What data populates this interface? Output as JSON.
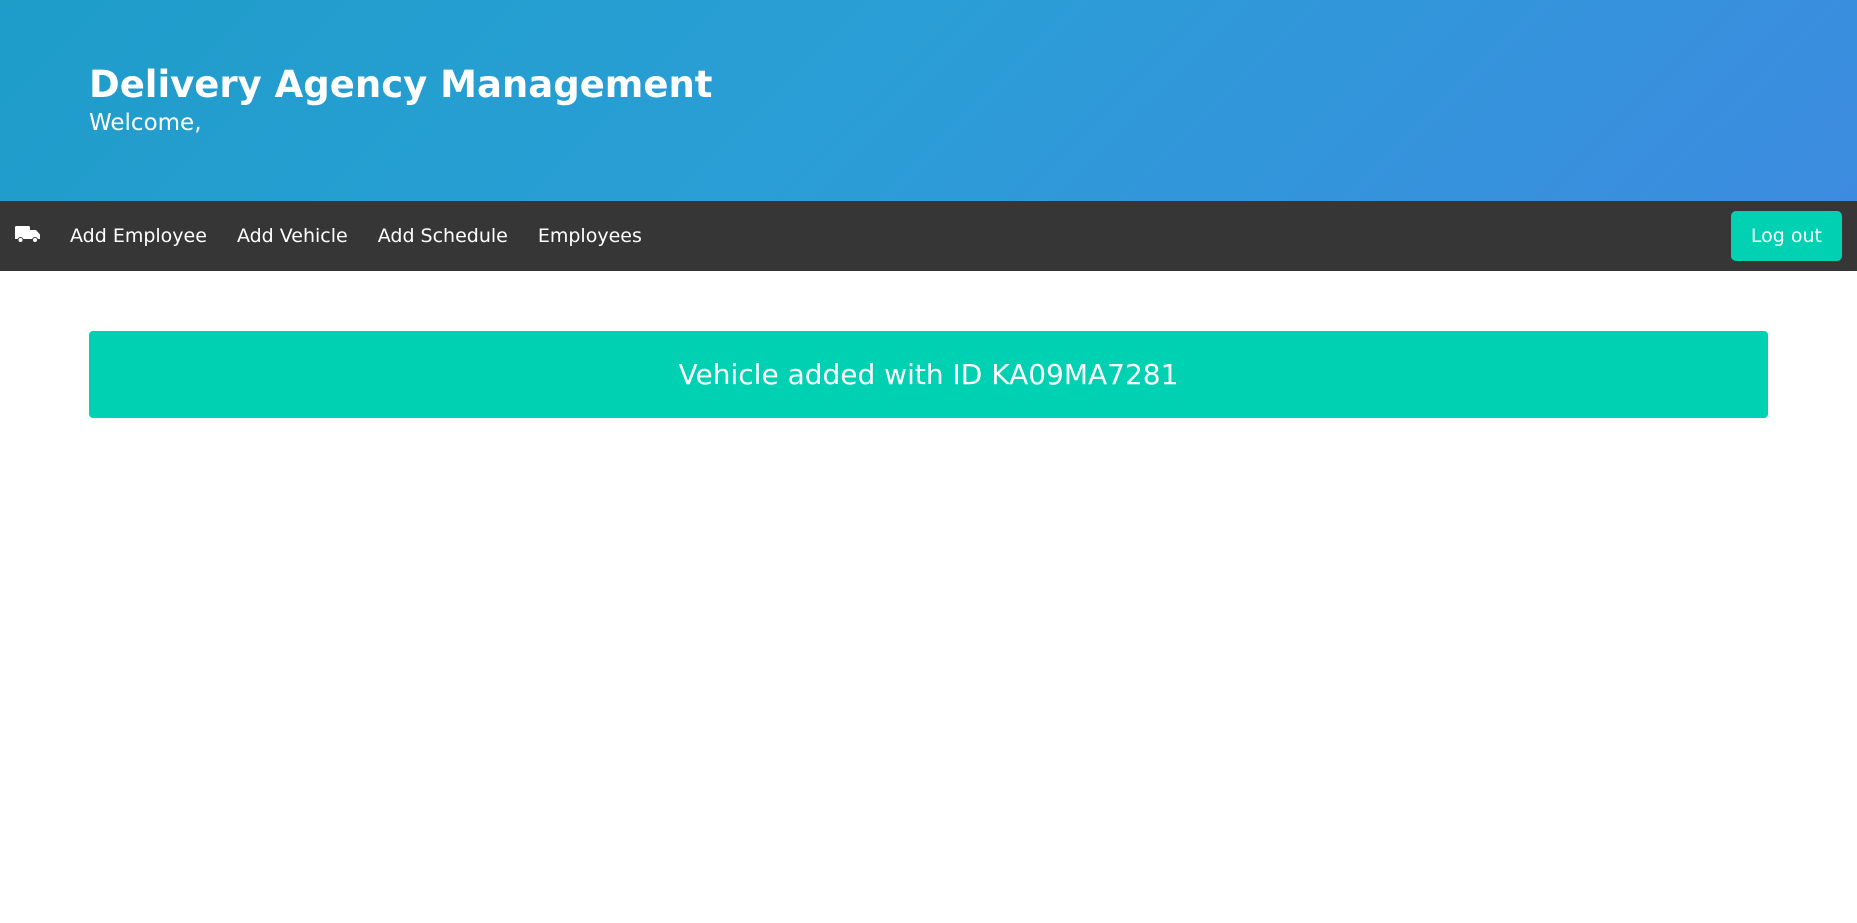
{
  "header": {
    "title": "Delivery Agency Management",
    "subtitle": "Welcome,"
  },
  "navbar": {
    "brand_icon": "truck-icon",
    "items": [
      {
        "label": "Add Employee"
      },
      {
        "label": "Add Vehicle"
      },
      {
        "label": "Add Schedule"
      },
      {
        "label": "Employees"
      }
    ],
    "logout_label": "Log out"
  },
  "notification": {
    "message": "Vehicle added with ID KA09MA7281"
  },
  "colors": {
    "hero_gradient_start": "#1e9dc9",
    "hero_gradient_end": "#3d8be0",
    "navbar_bg": "#363636",
    "accent": "#00d1b2"
  }
}
